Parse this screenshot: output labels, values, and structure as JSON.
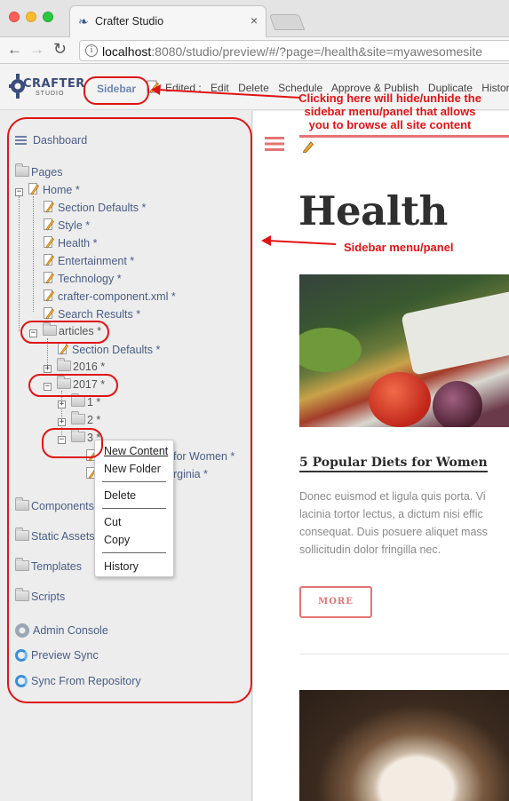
{
  "browser": {
    "tab_title": "Crafter Studio",
    "tab_close": "×",
    "url_host": "localhost",
    "url_rest": ":8080/studio/preview/#/?page=/health&site=myawesomesite",
    "info_icon": "i"
  },
  "studio_toolbar": {
    "logo_text": "CRAFTER",
    "logo_sub": "STUDIO",
    "sidebar_toggle": "Sidebar",
    "edited_label": "Edited :",
    "actions": [
      "Edit",
      "Delete",
      "Schedule",
      "Approve & Publish",
      "Duplicate",
      "History"
    ]
  },
  "annotations": {
    "sidebar_toggle_note": "Clicking here will hide/unhide the sidebar menu/panel that allows you to browse all site content",
    "sidebar_panel_note": "Sidebar menu/panel",
    "accent_color": "#e01414"
  },
  "sidebar": {
    "dashboard": "Dashboard",
    "pages": "Pages",
    "home": "Home *",
    "home_children": [
      "Section Defaults *",
      "Style *",
      "Health *",
      "Entertainment *",
      "Technology *",
      "crafter-component.xml *",
      "Search Results *"
    ],
    "articles": "articles *",
    "articles_section_defaults": "Section Defaults *",
    "year_2016": "2016 *",
    "year_2017": "2017 *",
    "month_1": "1 *",
    "month_2": "2 *",
    "month_3": "3 *",
    "month3_child_1": "for Women *",
    "month3_child_2": "rginia *",
    "components": "Components",
    "static_assets": "Static Assets",
    "templates": "Templates",
    "scripts": "Scripts",
    "admin_console": "Admin Console",
    "preview_sync": "Preview Sync",
    "sync_from_repository": "Sync From Repository",
    "expand_symbol": "+",
    "collapse_symbol": "−"
  },
  "context_menu": {
    "items": [
      "New Content",
      "New Folder",
      "Delete",
      "Cut",
      "Copy",
      "History"
    ]
  },
  "preview": {
    "page_title": "Health",
    "article_title": "5 Popular Diets for Women",
    "excerpt_lines": [
      "Donec euismod et ligula quis porta. Vi",
      "lacinia tortor lectus, a dictum nisi effic",
      "consequat. Duis posuere aliquet mass",
      "sollicitudin dolor fringilla nec."
    ],
    "more_button": "MORE",
    "accent_color": "#e57373"
  }
}
